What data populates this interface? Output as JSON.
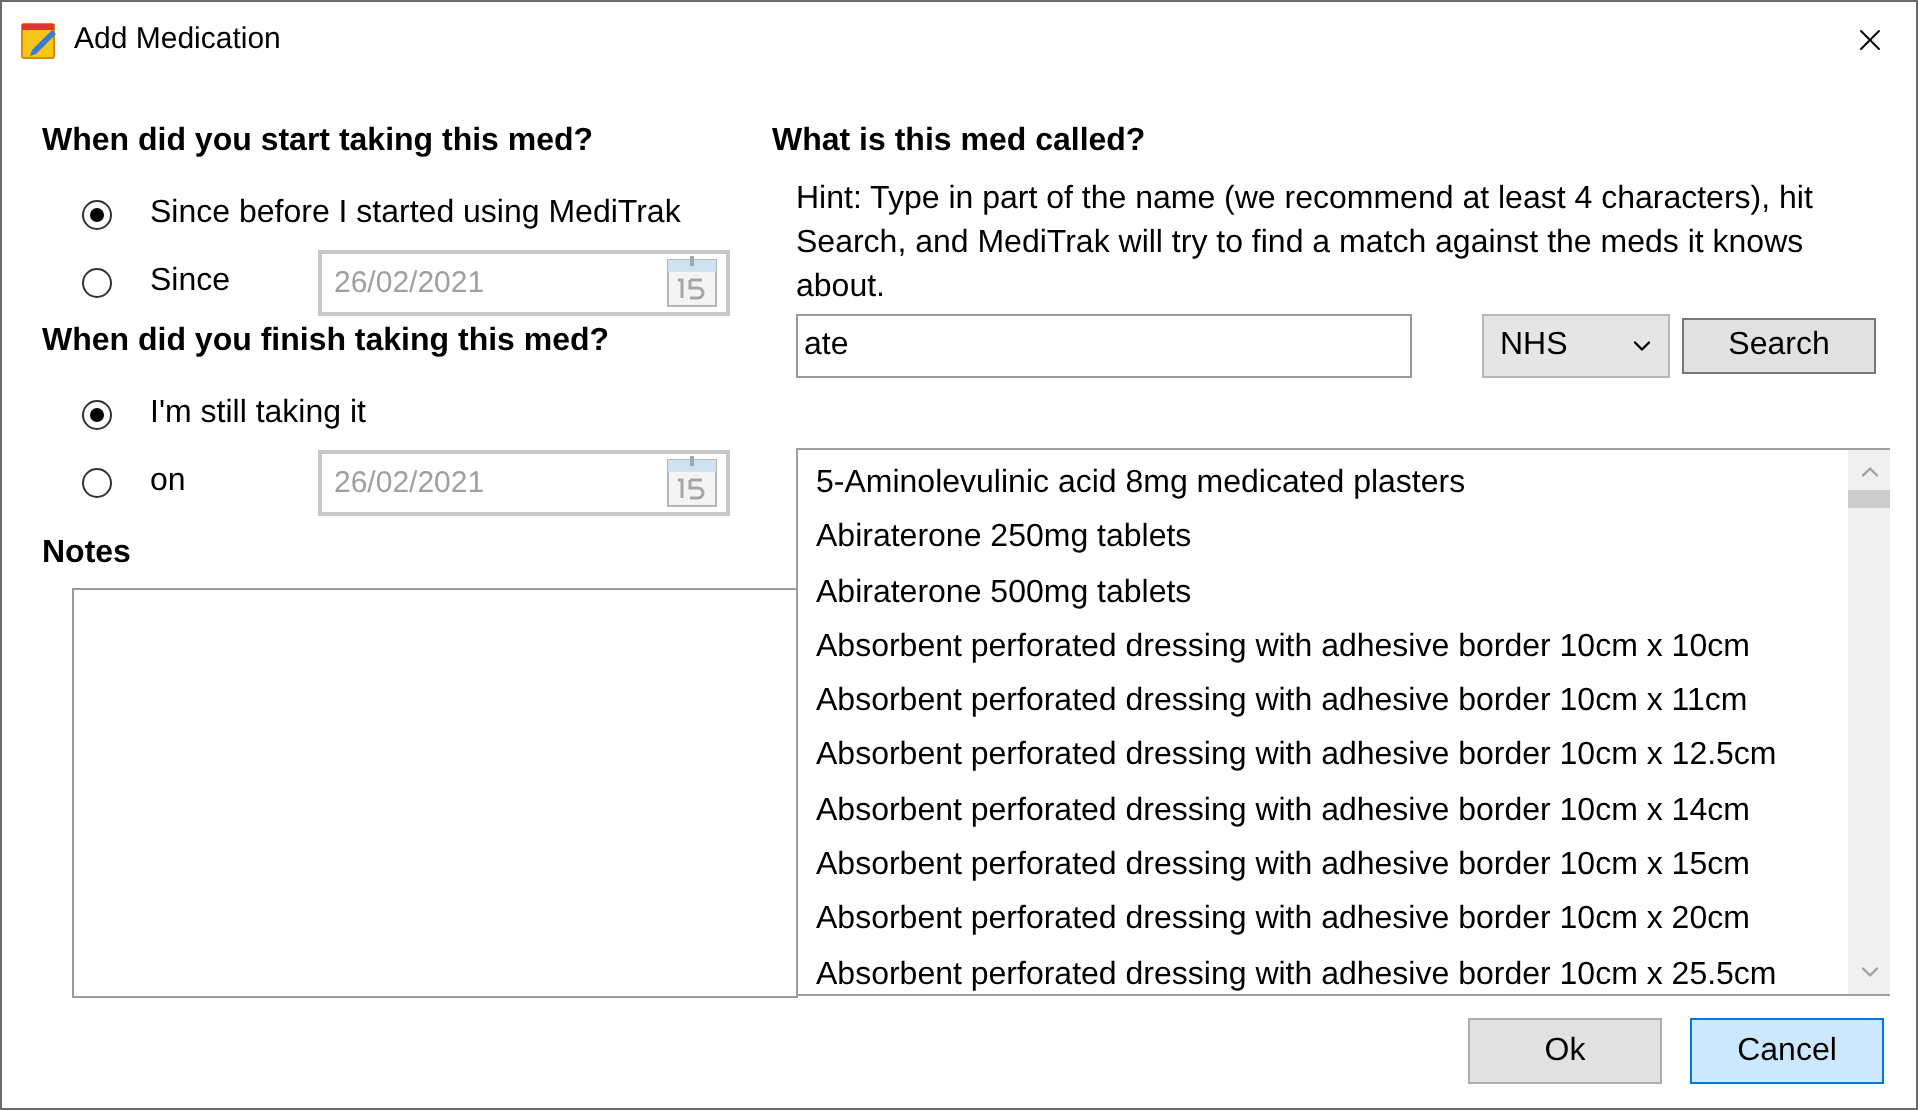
{
  "window": {
    "title": "Add Medication"
  },
  "start": {
    "heading": "When did you start taking this med?",
    "options": [
      {
        "label": "Since before I started using MediTrak",
        "selected": true
      },
      {
        "label": "Since",
        "selected": false,
        "date": "26/02/2021",
        "date_disabled": true
      }
    ]
  },
  "finish": {
    "heading": "When did you finish taking this med?",
    "options": [
      {
        "label": "I'm still taking it",
        "selected": true
      },
      {
        "label": "on",
        "selected": false,
        "date": "26/02/2021",
        "date_disabled": true
      }
    ]
  },
  "notes": {
    "label": "Notes"
  },
  "med": {
    "heading": "What is this med called?",
    "hint": "Hint: Type in part of the name (we recommend at least 4 characters), hit Search, and MediTrak will try to find a match against the meds it knows about.",
    "query": "ate",
    "source": "NHS",
    "search_button": "Search"
  },
  "results": [
    "5-Aminolevulinic acid 8mg medicated plasters",
    "Abiraterone 250mg tablets",
    "Abiraterone 500mg tablets",
    "Absorbent perforated dressing with adhesive border 10cm x 10cm",
    "Absorbent perforated dressing with adhesive border 10cm x 11cm",
    "Absorbent perforated dressing with adhesive border 10cm x 12.5cm",
    "Absorbent perforated dressing with adhesive border 10cm x 14cm",
    "Absorbent perforated dressing with adhesive border 10cm x 15cm",
    "Absorbent perforated dressing with adhesive border 10cm x 20cm",
    "Absorbent perforated dressing with adhesive border 10cm x 25.5cm"
  ],
  "buttons": [
    {
      "label": "Ok",
      "highlighted": false
    },
    {
      "label": "Cancel",
      "highlighted": true
    }
  ]
}
